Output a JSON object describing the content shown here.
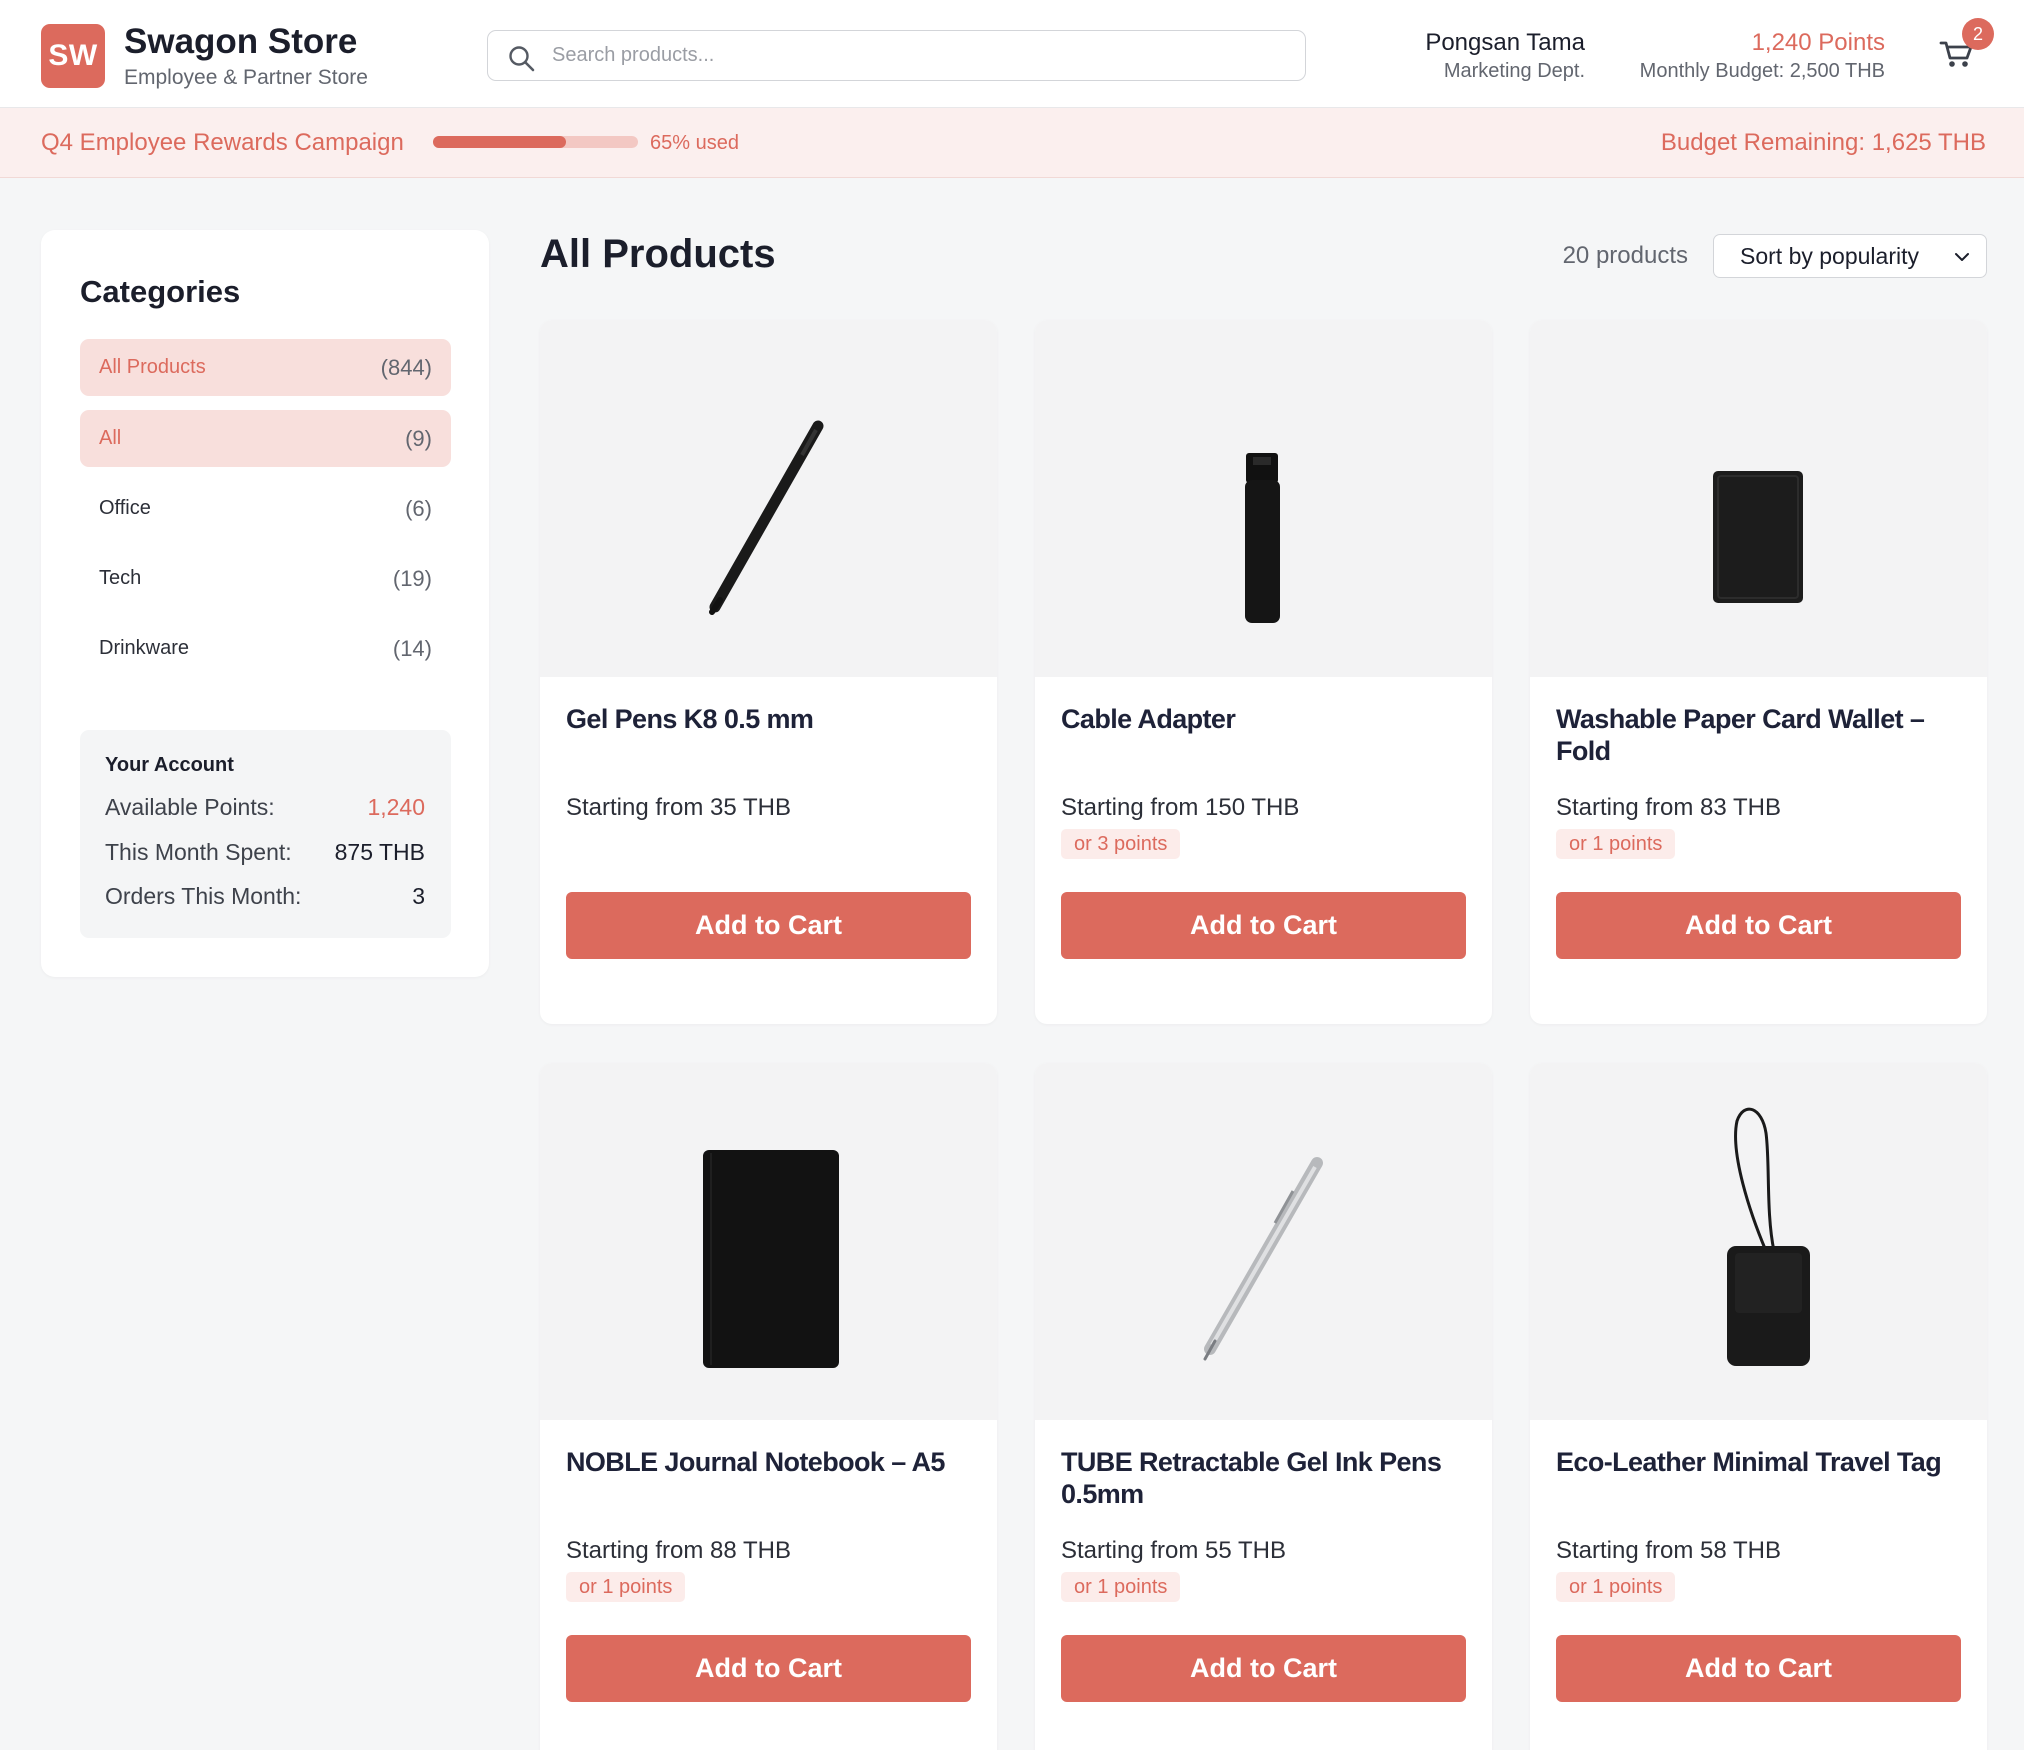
{
  "brand": {
    "initials": "SW",
    "name": "Swagon Store",
    "subtitle": "Employee & Partner Store"
  },
  "search": {
    "placeholder": "Search products..."
  },
  "user": {
    "name": "Pongsan Tama",
    "department": "Marketing Dept.",
    "points": "1,240 Points",
    "budget": "Monthly Budget: 2,500 THB"
  },
  "cart": {
    "count": "2"
  },
  "campaign": {
    "title": "Q4 Employee Rewards Campaign",
    "used_fraction": 0.65,
    "used_label": "65% used",
    "budget_remaining": "Budget Remaining: 1,625 THB"
  },
  "sidebar": {
    "title": "Categories",
    "categories": [
      {
        "label": "All Products",
        "count": "(844)",
        "active": true
      },
      {
        "label": "All",
        "count": "(9)",
        "active": true
      },
      {
        "label": "Office",
        "count": "(6)",
        "active": false
      },
      {
        "label": "Tech",
        "count": "(19)",
        "active": false
      },
      {
        "label": "Drinkware",
        "count": "(14)",
        "active": false
      }
    ],
    "account": {
      "title": "Your Account",
      "rows": [
        {
          "label": "Available Points:",
          "value": "1,240"
        },
        {
          "label": "This Month Spent:",
          "value": "875 THB"
        },
        {
          "label": "Orders This Month:",
          "value": "3"
        }
      ]
    }
  },
  "main": {
    "title": "All Products",
    "count": "20 products",
    "sort": "Sort by popularity",
    "add_label": "Add to Cart"
  },
  "products": [
    {
      "name": "Gel Pens K8 0.5 mm",
      "price": "Starting from 35 THB",
      "points": "",
      "image": "black-pen"
    },
    {
      "name": "Cable Adapter",
      "price": "Starting from 150 THB",
      "points": "or 3 points",
      "image": "black-cable-adapter"
    },
    {
      "name": "Washable Paper Card Wallet – Fold",
      "price": "Starting from 83 THB",
      "points": "or 1 points",
      "image": "black-card-wallet"
    },
    {
      "name": "NOBLE Journal Notebook – A5",
      "price": "Starting from 88 THB",
      "points": "or 1 points",
      "image": "black-notebook"
    },
    {
      "name": "TUBE Retractable Gel Ink Pens 0.5mm",
      "price": "Starting from 55 THB",
      "points": "or 1 points",
      "image": "silver-pen"
    },
    {
      "name": "Eco-Leather Minimal Travel Tag",
      "price": "Starting from 58 THB",
      "points": "or 1 points",
      "image": "black-luggage-tag"
    }
  ],
  "colors": {
    "accent": "#dc6a5d",
    "accent_light": "#fbefee",
    "background": "#f5f6f7"
  }
}
